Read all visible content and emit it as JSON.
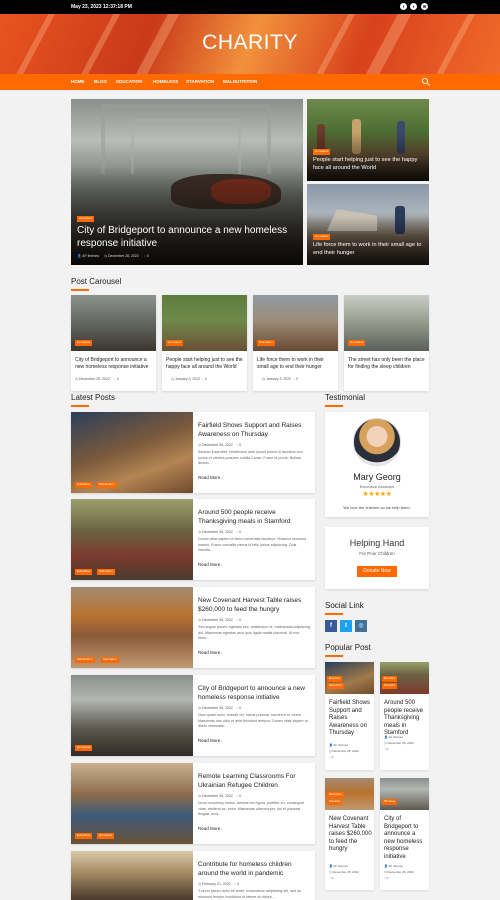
{
  "topbar": {
    "datetime": "May 23, 2023 12:37:18 PM",
    "social": [
      {
        "icon": "facebook-icon",
        "glyph": "f"
      },
      {
        "icon": "twitter-icon",
        "glyph": "t"
      },
      {
        "icon": "email-icon",
        "glyph": "✉"
      }
    ]
  },
  "site": {
    "title": "CHARITY"
  },
  "nav": {
    "items": [
      "HOME",
      "BLOG",
      "EDUCATION",
      "HOMELESS",
      "STARVATION",
      "MALNUTRITION"
    ]
  },
  "featured": {
    "main": {
      "badge": "Homeless",
      "title": "City of Bridgeport to announce a new homeless response initiative",
      "author": "AF themes",
      "date": "December 28, 2022",
      "comments": "0"
    },
    "side": [
      {
        "badge": "Homeless",
        "title": "People start helping just to see the happy face all around the World"
      },
      {
        "badge": "Homeless",
        "title": "Life force them to work in their small age to end their hunger"
      }
    ]
  },
  "carousel": {
    "heading": "Post Carousel",
    "items": [
      {
        "badge": "Homeless",
        "title": "City of Bridgeport to announce a new homeless response initiative",
        "date": "December 28, 2022",
        "comments": "0"
      },
      {
        "badge": "Homeless",
        "title": "People start helping just to see the happy face all around the World",
        "date": "January 3, 2022",
        "comments": "0"
      },
      {
        "badge": "Starvation",
        "title": "Life force them to work in their small age to end their hunger",
        "date": "January 3, 2022",
        "comments": "0"
      },
      {
        "badge": "Homeless",
        "title": "The street has only been the place for finding the sleep children",
        "date": "January 3, 2022",
        "comments": "0"
      }
    ]
  },
  "latest": {
    "heading": "Latest Posts",
    "read_more": "Read More..",
    "posts": [
      {
        "badges": [
          "Education",
          "Malnutrition"
        ],
        "title": "Fairfield Shows Support and Raises Awareness on Thursday",
        "date": "December 28, 2022",
        "comments": "0",
        "excerpt": "Aenean imperdiet. Vestibulum ante ipsum primis in faucibus orci luctus et ultrices posuere cubilia Curae; Fusce id purus. Nullam dictum..."
      },
      {
        "badges": [
          "Education",
          "Starvation"
        ],
        "title": "Around 500 people receive Thanksgiving meals in Stamford",
        "date": "December 28, 2022",
        "comments": "0",
        "excerpt": "Donec vitae sapien ut libero venenatis faucibus. Vivamus euismod mauris. Fusce convallis metus id felis luctus adipiscing. Duis lobortis..."
      },
      {
        "badges": [
          "Malnutrition",
          "Starvation"
        ],
        "title": "New Covenant Harvest Table raises $260,000 to feed the hungry",
        "date": "December 28, 2022",
        "comments": "0",
        "excerpt": "Sed augue ipsum, egestas nec, vestibulum et, malesuada adipiscing, dui. Maecenas egestas arcu quis ligula mattis placerat. Ut non enim..."
      },
      {
        "badges": [
          "Homeless"
        ],
        "title": "City of Bridgeport to announce a new homeless response initiative",
        "date": "December 28, 2022",
        "comments": "0",
        "excerpt": "Nam quam nunc, blandit vel, luctus pulvinar, hendrerit id, lorem. Maecenas nec odio et ante tincidunt tempus. Donec vitae sapien ut libero venenatis..."
      },
      {
        "badges": [
          "Education",
          "Homeless"
        ],
        "title": "Remote Learning Classrooms For Ukrainian Refugee Children",
        "date": "December 28, 2022",
        "comments": "0",
        "excerpt": "Nunc nonummy metus. Aenean leo ligula, porttitor eu, consequat vitae, eleifend ac, enim. Maecenas ullamcorper, dui et placerat feugiat, eros..."
      },
      {
        "badges": [],
        "title": "Contribute for homeless children around the world in pandemic",
        "date": "February 21, 2022",
        "comments": "0",
        "excerpt": "\"Lorem ipsum dolor sit amet, consectetur adipiscing elit, sed do eiusmod tempor incididunt ut labore et dolore..."
      }
    ]
  },
  "testimonial": {
    "heading": "Testimonial",
    "name": "Mary Georg",
    "role": "Executive Assistant",
    "stars": "★★★★★",
    "quote": "We love the children so we help them."
  },
  "helping": {
    "title": "Helping Hand",
    "subtitle": "For Poor Children",
    "button": "Donate Now"
  },
  "social_link": {
    "heading": "Social Link",
    "icons": [
      {
        "icon": "facebook-icon",
        "glyph": "f",
        "color": "#3b5998"
      },
      {
        "icon": "twitter-icon",
        "glyph": "t",
        "color": "#1da1f2"
      },
      {
        "icon": "instagram-icon",
        "glyph": "◎",
        "color": "#3f729b"
      }
    ]
  },
  "popular": {
    "heading": "Popular Post",
    "posts": [
      {
        "badges": [
          "Education",
          "Malnutrition"
        ],
        "title": "Fairfield Shows Support and Raises Awareness on Thursday",
        "author": "AF themes",
        "date": "December 28, 2022",
        "comments": "0"
      },
      {
        "badges": [
          "Education",
          "Starvation"
        ],
        "title": "Around 500 people receive Thanksgiving meals in Stamford",
        "author": "AF themes",
        "date": "December 28, 2022",
        "comments": "0"
      },
      {
        "badges": [
          "Malnutrition",
          "Starvation"
        ],
        "title": "New Covenant Harvest Table raises $260,000 to feed the hungry",
        "author": "AF themes",
        "date": "December 28, 2022",
        "comments": "0"
      },
      {
        "badges": [
          "Homeless"
        ],
        "title": "City of Bridgeport to announce a new homeless response initiative",
        "author": "AF themes",
        "date": "December 28, 2022",
        "comments": "0"
      }
    ]
  },
  "colors": {
    "accent": "#ff6a00",
    "topbar": "#000000",
    "background": "#f2f2f2"
  }
}
